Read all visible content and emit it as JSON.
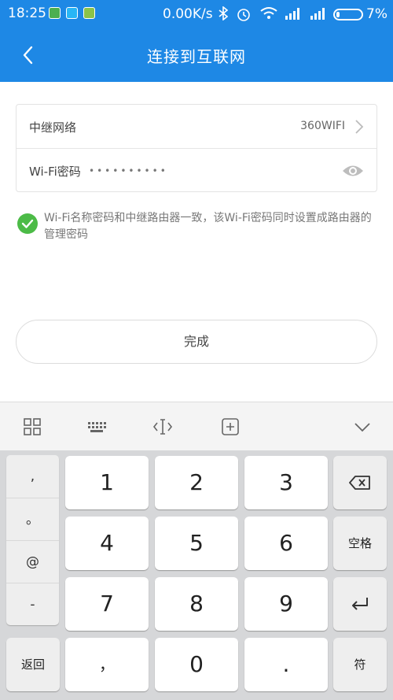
{
  "status_bar": {
    "time": "18:25",
    "network_speed": "0.00K/s",
    "battery": "7%"
  },
  "header": {
    "title": "连接到互联网",
    "back_icon": "back-arrow-icon"
  },
  "form": {
    "relay_network_label": "中继网络",
    "relay_network_value": "360WIFI",
    "wifi_password_label": "Wi-Fi密码",
    "wifi_password_mask": "••••••••••"
  },
  "note": {
    "checked": true,
    "text": "Wi-Fi名称密码和中继路由器一致，该Wi-Fi密码同时设置成路由器的管理密码"
  },
  "done_button": "完成",
  "keyboard": {
    "toolbar_icons": [
      "grid-icon",
      "keyboard-icon",
      "cursor-icon",
      "plus-box-icon",
      "chevron-down-icon"
    ],
    "symbols": [
      ",",
      "。",
      "@",
      "-"
    ],
    "digits": [
      "1",
      "2",
      "3",
      "4",
      "5",
      "6",
      "7",
      "8",
      "9",
      "0"
    ],
    "back_label": "返回",
    "comma_label": "，",
    "dot_label": ".",
    "space_label": "空格",
    "symbol_label": "符"
  },
  "colors": {
    "header_blue": "#1e88e5",
    "check_green": "#4cbb47"
  }
}
